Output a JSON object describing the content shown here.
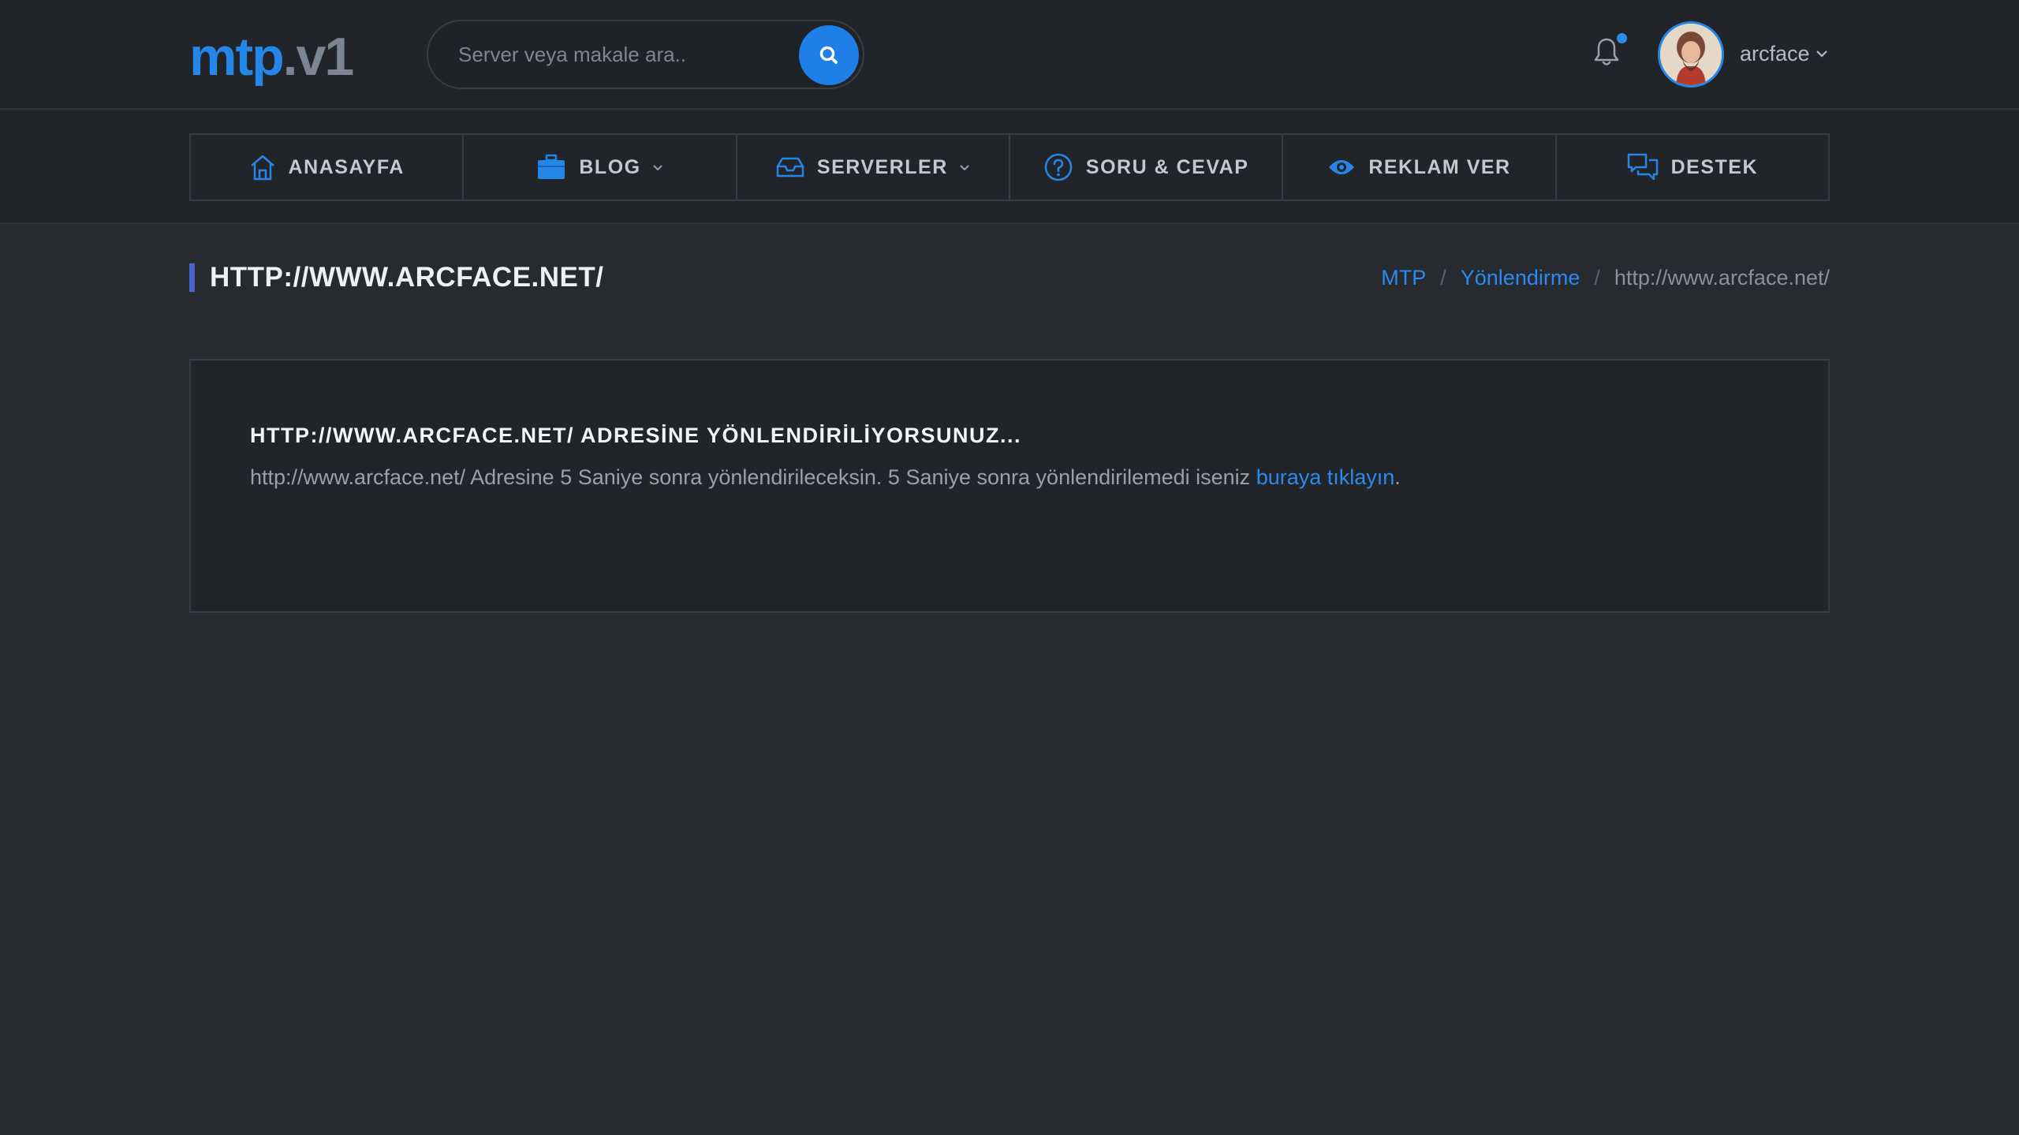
{
  "header": {
    "logo_main": "mtp",
    "logo_version": ".v1",
    "search_placeholder": "Server veya makale ara..",
    "username": "arcface"
  },
  "nav": {
    "items": [
      {
        "label": "ANASAYFA",
        "icon": "home-icon"
      },
      {
        "label": "BLOG",
        "icon": "briefcase-icon",
        "dropdown": true
      },
      {
        "label": "SERVERLER",
        "icon": "inbox-icon",
        "dropdown": true
      },
      {
        "label": "SORU & CEVAP",
        "icon": "question-icon"
      },
      {
        "label": "REKLAM VER",
        "icon": "eye-icon"
      },
      {
        "label": "DESTEK",
        "icon": "chat-icon"
      }
    ]
  },
  "page": {
    "title": "HTTP://WWW.ARCFACE.NET/",
    "breadcrumb": {
      "home": "MTP",
      "section": "Yönlendirme",
      "current": "http://www.arcface.net/",
      "separator": "/"
    }
  },
  "card": {
    "title": "HTTP://WWW.ARCFACE.NET/ ADRESİNE YÖNLENDİRİLİYORSUNUZ...",
    "text": "http://www.arcface.net/ Adresine 5 Saniye sonra yönlendirileceksin. 5 Saniye sonra yönlendirilemedi iseniz ",
    "link_text": "buraya tıklayın",
    "text_end": "."
  },
  "colors": {
    "accent": "#2487e8",
    "background": "#272a2f",
    "panel": "#212428",
    "title_marker": "#4a63d3"
  }
}
